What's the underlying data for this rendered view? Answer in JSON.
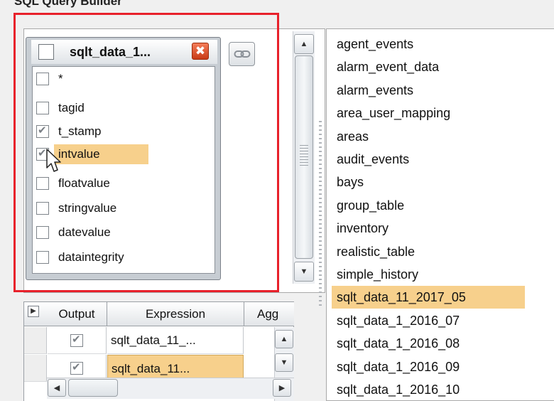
{
  "app": {
    "title": "SQL Query Builder"
  },
  "table_window": {
    "title": "sqlt_data_1...",
    "close_glyph": "✖",
    "columns": [
      {
        "label": "*",
        "checked": false,
        "highlighted": false
      },
      {
        "label": "tagid",
        "checked": false,
        "highlighted": false
      },
      {
        "label": "t_stamp",
        "checked": true,
        "highlighted": false
      },
      {
        "label": "intvalue",
        "checked": true,
        "highlighted": true
      },
      {
        "label": "floatvalue",
        "checked": false,
        "highlighted": false
      },
      {
        "label": "stringvalue",
        "checked": false,
        "highlighted": false
      },
      {
        "label": "datevalue",
        "checked": false,
        "highlighted": false
      },
      {
        "label": "dataintegrity",
        "checked": false,
        "highlighted": false
      }
    ]
  },
  "grid": {
    "headers": [
      "Output",
      "Expression",
      "Agg"
    ],
    "rows": [
      {
        "output": true,
        "expression": "sqlt_data_11_...",
        "selected": false
      },
      {
        "output": true,
        "expression": "sqlt_data_11...",
        "selected": true
      }
    ]
  },
  "tables_list": {
    "items": [
      "agent_events",
      "alarm_event_data",
      "alarm_events",
      "area_user_mapping",
      "areas",
      "audit_events",
      "bays",
      "group_table",
      "inventory",
      "realistic_table",
      "simple_history",
      "sqlt_data_11_2017_05",
      "sqlt_data_1_2016_07",
      "sqlt_data_1_2016_08",
      "sqlt_data_1_2016_09",
      "sqlt_data_1_2016_10"
    ],
    "selected": "sqlt_data_11_2017_05"
  },
  "colors": {
    "highlight": "#f7d08c",
    "annotation_box": "#e8212b",
    "close_button": "#d9461e"
  },
  "icons": [
    "chain-link-icon",
    "close-icon",
    "expand-icon",
    "arrow-up-icon",
    "arrow-down-icon",
    "arrow-left-icon",
    "arrow-right-icon",
    "mouse-pointer-icon"
  ]
}
